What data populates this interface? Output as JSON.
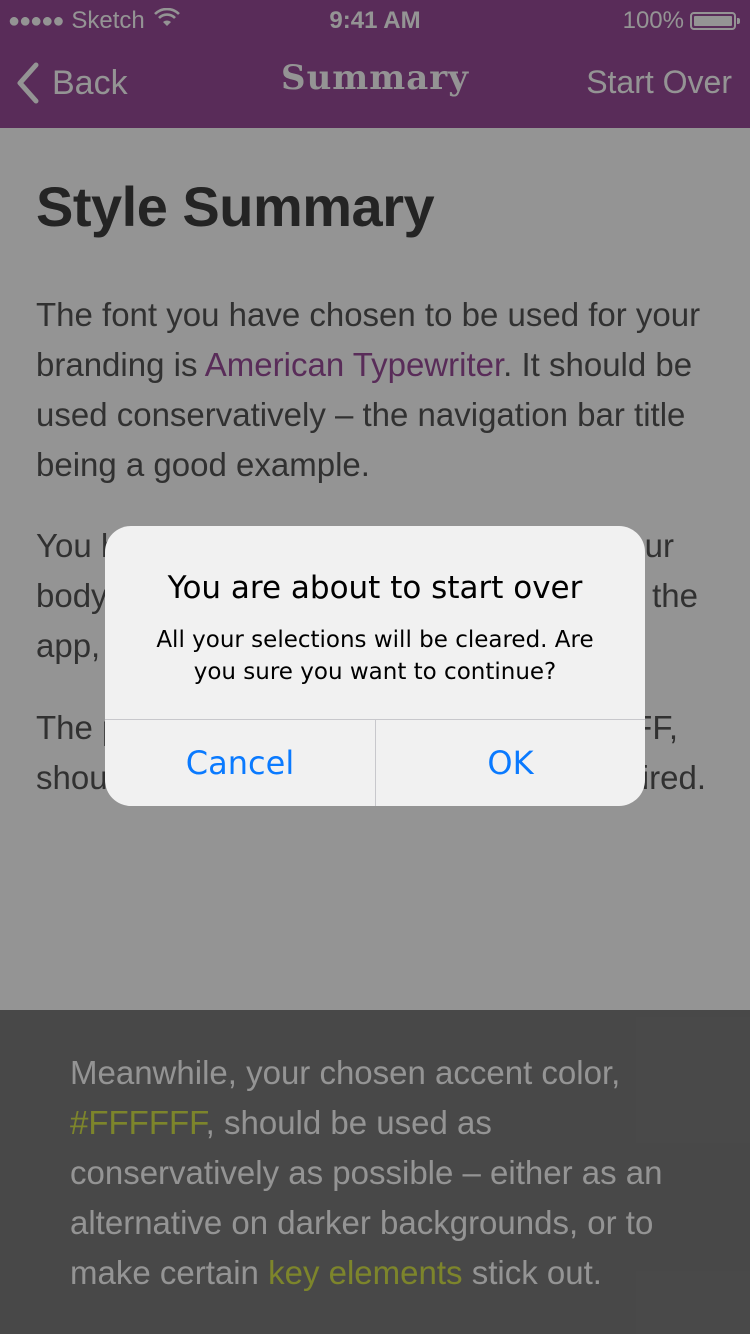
{
  "status_bar": {
    "signal_dots": "●●●●●",
    "carrier": "Sketch",
    "time": "9:41 AM",
    "battery": "100%"
  },
  "nav": {
    "back_label": "Back",
    "title": "Summary",
    "start_over_label": "Start Over"
  },
  "content": {
    "heading": "Style Summary",
    "p1_before": "The font you have chosen to be used for your branding is ",
    "p1_font": "American Typewriter",
    "p1_after": ". It should be used conservatively – the navigation bar title being a good example.",
    "p2_left_l1": "You h",
    "p2_right_l1": "ur",
    "p2_left_l2": "body",
    "p2_right_l2": "the",
    "p2_left_l3": "app,",
    "p3_left_l1": "The p",
    "p3_right_l1": "FF,",
    "p3_left_l2": "shou",
    "p3_right_l2": "ired."
  },
  "footer": {
    "text_before": "Meanwhile, your chosen accent color, ",
    "accent_hex": "#FFFFFF",
    "text_middle": ", should be used as conservatively as possible – either as an alternative on darker backgrounds, or to make certain ",
    "key_elements": "key elements",
    "text_after": " stick out."
  },
  "alert": {
    "title": "You are about to start over",
    "message": "All your selections will be cleared. Are you sure you want to continue?",
    "cancel_label": "Cancel",
    "ok_label": "OK"
  },
  "colors": {
    "brand": "#9a4d9a",
    "accent": "#FFFFFF",
    "alert_button": "#0a7aff"
  }
}
